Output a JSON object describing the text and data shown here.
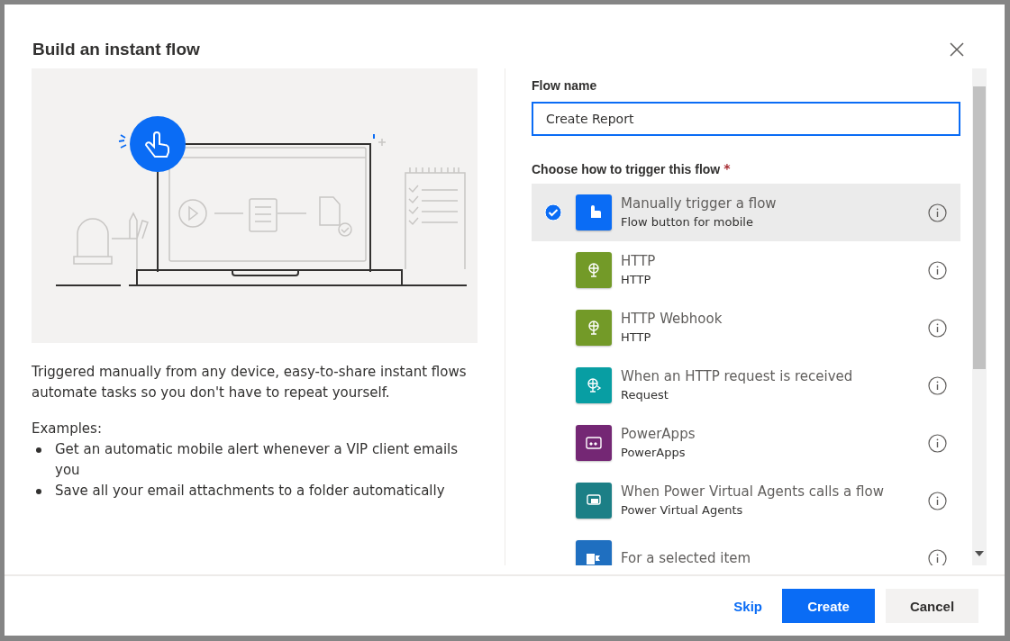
{
  "dialog": {
    "title": "Build an instant flow"
  },
  "description": "Triggered manually from any device, easy-to-share instant flows automate tasks so you don't have to repeat yourself.",
  "examples_label": "Examples:",
  "examples": [
    "Get an automatic mobile alert whenever a VIP client emails you",
    "Save all your email attachments to a folder automatically"
  ],
  "flow_name": {
    "label": "Flow name",
    "value": "Create Report"
  },
  "trigger_label": {
    "text": "Choose how to trigger this flow",
    "required_mark": "*"
  },
  "triggers": [
    {
      "title": "Manually trigger a flow",
      "subtitle": "Flow button for mobile",
      "kind": "touch",
      "color": "#0a6cf5",
      "selected": true
    },
    {
      "title": "HTTP",
      "subtitle": "HTTP",
      "kind": "globe",
      "color": "#739a28",
      "selected": false
    },
    {
      "title": "HTTP Webhook",
      "subtitle": "HTTP",
      "kind": "globe",
      "color": "#739a28",
      "selected": false
    },
    {
      "title": "When an HTTP request is received",
      "subtitle": "Request",
      "kind": "request",
      "color": "#089ea3",
      "selected": false
    },
    {
      "title": "PowerApps",
      "subtitle": "PowerApps",
      "kind": "apps",
      "color": "#742774",
      "selected": false
    },
    {
      "title": "When Power Virtual Agents calls a flow",
      "subtitle": "Power Virtual Agents",
      "kind": "chat",
      "color": "#1c7f86",
      "selected": false
    },
    {
      "title": "For a selected item",
      "kind": "list",
      "color": "#1f6fc0",
      "selected": false
    }
  ],
  "buttons": [
    {
      "label": "Skip",
      "kind": "link"
    },
    {
      "label": "Create",
      "kind": "primary"
    },
    {
      "label": "Cancel",
      "kind": "default"
    }
  ]
}
